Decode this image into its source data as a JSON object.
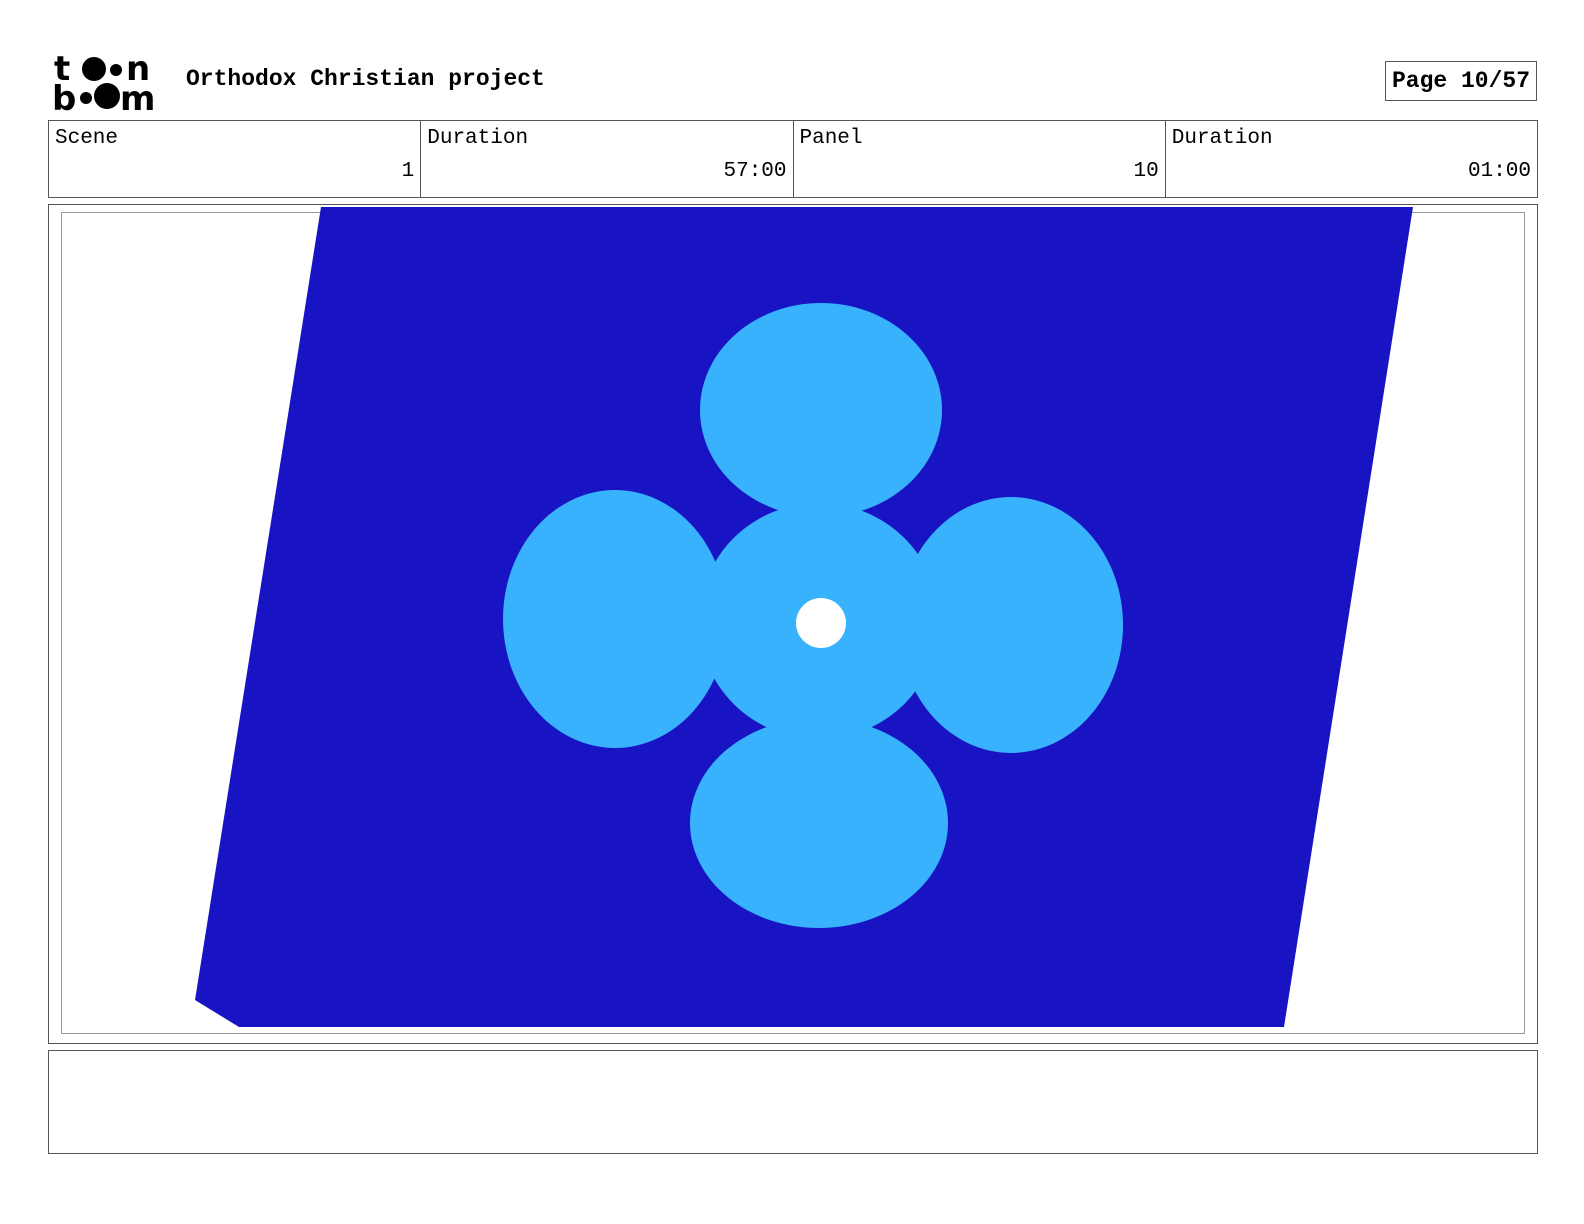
{
  "header": {
    "logo_lines": [
      "t",
      "n",
      "b",
      "m"
    ],
    "project_title": "Orthodox Christian project",
    "page_label": "Page 10/57"
  },
  "info": {
    "scene_label": "Scene",
    "scene_value": "1",
    "scene_duration_label": "Duration",
    "scene_duration_value": "57:00",
    "panel_label": "Panel",
    "panel_value": "10",
    "panel_duration_label": "Duration",
    "panel_duration_value": "01:00"
  },
  "artwork": {
    "background_color": "#1814c4",
    "quatrefoil_color": "#38b2fc",
    "center_dot_color": "#ffffff"
  },
  "caption": {
    "text": ""
  }
}
